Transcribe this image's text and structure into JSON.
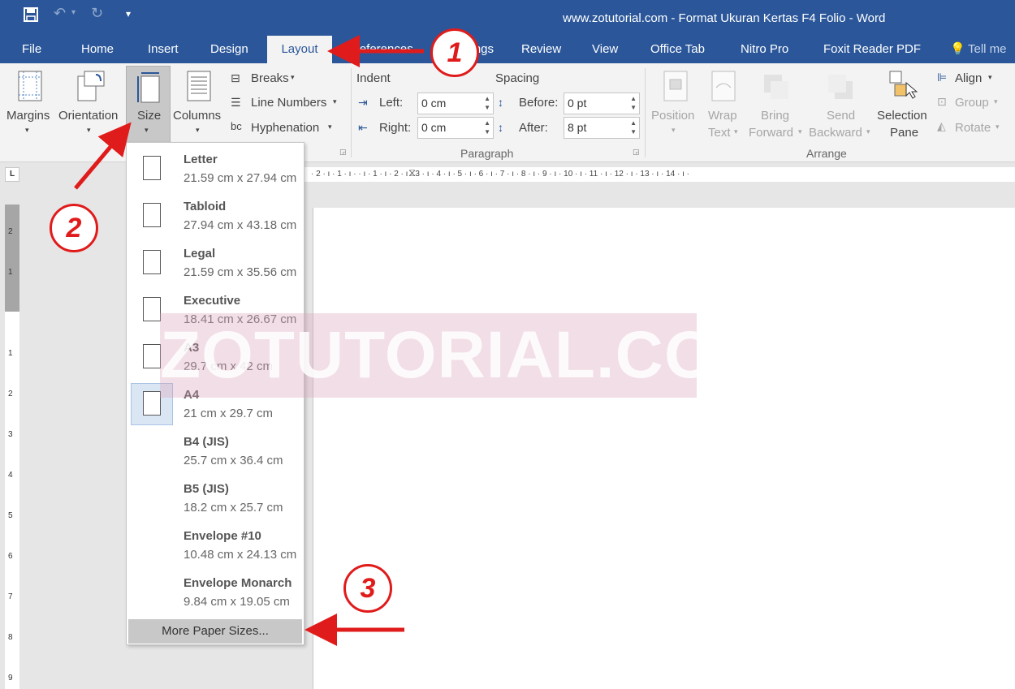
{
  "titlebar": {
    "title": "www.zotutorial.com - Format Ukuran Kertas F4 Folio - Word",
    "save_icon": "save-icon",
    "undo_icon": "undo-icon",
    "redo_icon": "redo-icon"
  },
  "tabs": [
    "File",
    "Home",
    "Insert",
    "Design",
    "Layout",
    "References",
    "Mailings",
    "Review",
    "View",
    "Office Tab",
    "Nitro Pro",
    "Foxit Reader PDF"
  ],
  "tell_me": "Tell me",
  "ribbon": {
    "margins": "Margins",
    "orientation": "Orientation",
    "size": "Size",
    "columns": "Columns",
    "breaks": "Breaks",
    "line_numbers": "Line Numbers",
    "hyphenation": "Hyphenation",
    "indent": {
      "label": "Indent",
      "left_label": "Left:",
      "left_value": "0 cm",
      "right_label": "Right:",
      "right_value": "0 cm"
    },
    "spacing": {
      "label": "Spacing",
      "before_label": "Before:",
      "before_value": "0 pt",
      "after_label": "After:",
      "after_value": "8 pt"
    },
    "paragraph_group": "Paragraph",
    "arrange_group": "Arrange",
    "position": "Position",
    "wrap_text_1": "Wrap",
    "wrap_text_2": "Text",
    "bring_forward_1": "Bring",
    "bring_forward_2": "Forward",
    "send_backward_1": "Send",
    "send_backward_2": "Backward",
    "selection_pane_1": "Selection",
    "selection_pane_2": "Pane",
    "align": "Align",
    "group": "Group",
    "rotate": "Rotate"
  },
  "ruler": {
    "tab_marker": "L",
    "top_text": "· 2 · ı · 1 · ı ·   · ı · 1 · ı · 2 · ı · 3 · ı · 4 · ı · 5 · ı · 6 · ı · 7 · ı · 8 · ı · 9 · ı · 10 · ı · 11 · ı · 12 · ı · 13 · ı · 14 · ı ·",
    "left_numbers": [
      "2",
      "1",
      "1",
      "2",
      "3",
      "4",
      "5",
      "6",
      "7",
      "8",
      "9"
    ]
  },
  "size_menu": {
    "items": [
      {
        "name": "Letter",
        "dims": "21.59 cm x 27.94 cm"
      },
      {
        "name": "Tabloid",
        "dims": "27.94 cm x 43.18 cm"
      },
      {
        "name": "Legal",
        "dims": "21.59 cm x 35.56 cm"
      },
      {
        "name": "Executive",
        "dims": "18.41 cm x 26.67 cm"
      },
      {
        "name": "A3",
        "dims": "29.7 cm x 42 cm"
      },
      {
        "name": "A4",
        "dims": "21 cm x 29.7 cm"
      },
      {
        "name": "B4 (JIS)",
        "dims": "25.7 cm x 36.4 cm"
      },
      {
        "name": "B5 (JIS)",
        "dims": "18.2 cm x 25.7 cm"
      },
      {
        "name": "Envelope #10",
        "dims": "10.48 cm x 24.13 cm"
      },
      {
        "name": "Envelope Monarch",
        "dims": "9.84 cm x 19.05 cm"
      }
    ],
    "selected": "A4",
    "more": "More Paper Sizes..."
  },
  "watermark": "ZOTUTORIAL.COM",
  "annotations": [
    "1",
    "2",
    "3"
  ],
  "colors": {
    "word_blue": "#2b579a",
    "annotation_red": "#e01b1b",
    "ribbon_bg": "#f3f3f3"
  }
}
